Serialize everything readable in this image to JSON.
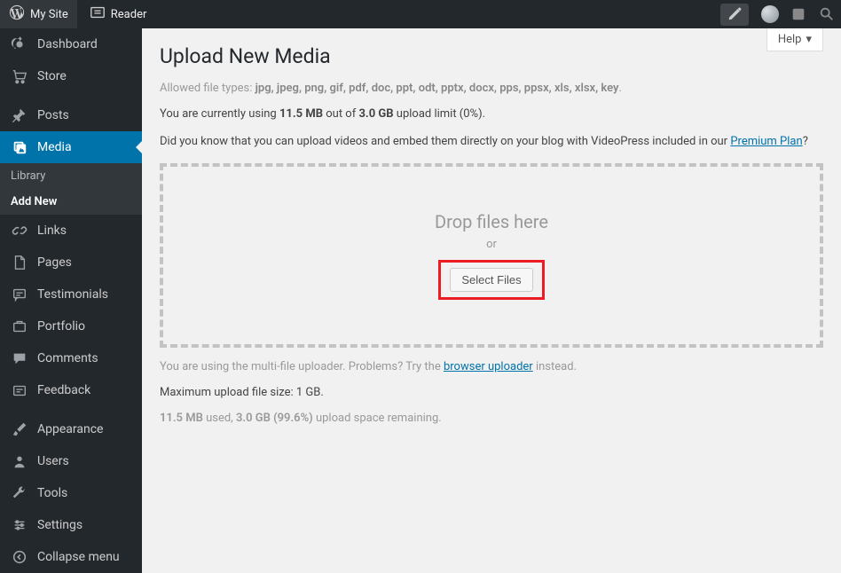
{
  "topbar": {
    "mysite": "My Site",
    "reader": "Reader"
  },
  "sidebar": {
    "dashboard": "Dashboard",
    "store": "Store",
    "posts": "Posts",
    "media": "Media",
    "media_sub": {
      "library": "Library",
      "addnew": "Add New"
    },
    "links": "Links",
    "pages": "Pages",
    "testimonials": "Testimonials",
    "portfolio": "Portfolio",
    "comments": "Comments",
    "feedback": "Feedback",
    "appearance": "Appearance",
    "users": "Users",
    "tools": "Tools",
    "settings": "Settings",
    "collapse": "Collapse menu"
  },
  "help": "Help",
  "page": {
    "title": "Upload New Media",
    "allowed_label": "Allowed file types: ",
    "allowed_types": "jpg, jpeg, png, gif, pdf, doc, ppt, odt, pptx, docx, pps, ppsx, xls, xlsx, key",
    "usage_pre": "You are currently using ",
    "usage_used": "11.5 MB",
    "usage_mid": " out of ",
    "usage_total": "3.0 GB",
    "usage_post": " upload limit (0%).",
    "tip_pre": "Did you know that you can upload videos and embed them directly on your blog with VideoPress included in our ",
    "tip_link": "Premium Plan",
    "tip_post": "?",
    "drop_title": "Drop files here",
    "drop_or": "or",
    "select_files": "Select Files",
    "uploader_pre": "You are using the multi-file uploader. Problems? Try the ",
    "uploader_link": "browser uploader",
    "uploader_post": " instead.",
    "maxsize": "Maximum upload file size: 1 GB.",
    "space_used": "11.5 MB",
    "space_used_label": " used, ",
    "space_total": "3.0 GB (99.6%)",
    "space_label": " upload space remaining."
  }
}
